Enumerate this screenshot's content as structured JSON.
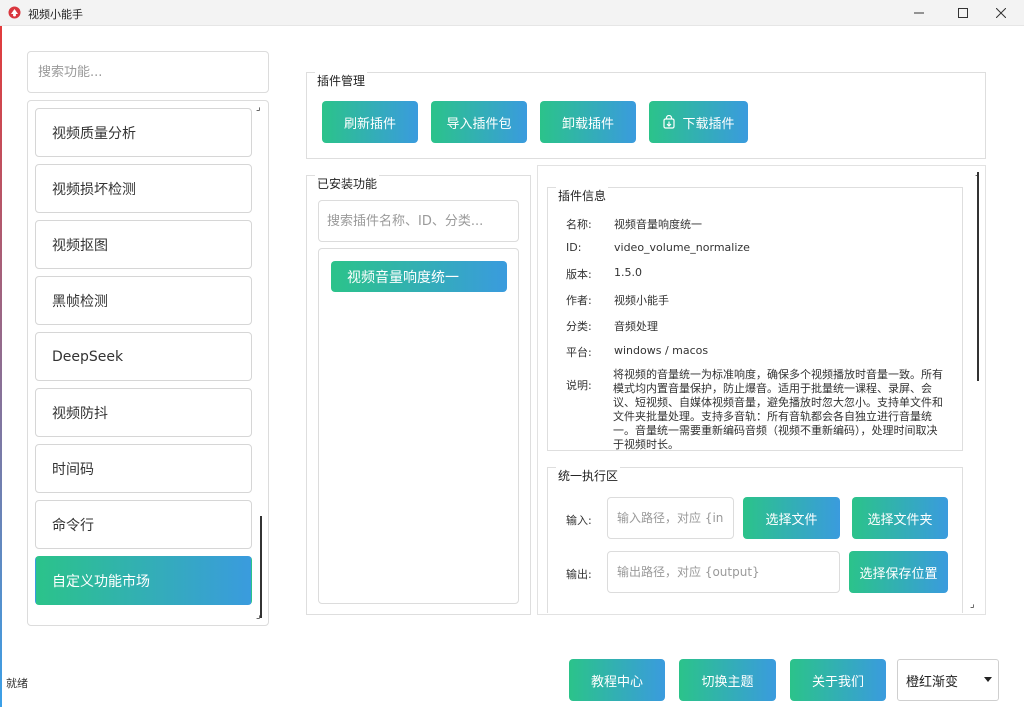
{
  "window": {
    "title": "视频小能手",
    "controls": [
      "minimize-icon",
      "maximize-icon",
      "close-icon"
    ]
  },
  "sidebar": {
    "search_placeholder": "搜索功能...",
    "items": [
      {
        "label": "视频质量分析"
      },
      {
        "label": "视频损坏检测"
      },
      {
        "label": "视频抠图"
      },
      {
        "label": "黑帧检测"
      },
      {
        "label": "DeepSeek"
      },
      {
        "label": "视频防抖"
      },
      {
        "label": "时间码"
      },
      {
        "label": "命令行"
      },
      {
        "label": "自定义功能市场",
        "active": true
      }
    ]
  },
  "plugin_manager": {
    "title": "插件管理",
    "buttons": {
      "refresh": "刷新插件",
      "import": "导入插件包",
      "uninstall": "卸载插件",
      "download": "下载插件"
    }
  },
  "installed": {
    "title": "已安装功能",
    "search_placeholder": "搜索插件名称、ID、分类...",
    "items": [
      "视频音量响度统一"
    ]
  },
  "plugin_info": {
    "title": "插件信息",
    "rows": [
      {
        "key": "名称:",
        "value": "视频音量响度统一"
      },
      {
        "key": "ID:",
        "value": "video_volume_normalize"
      },
      {
        "key": "版本:",
        "value": "1.5.0"
      },
      {
        "key": "作者:",
        "value": "视频小能手"
      },
      {
        "key": "分类:",
        "value": "音频处理"
      },
      {
        "key": "平台:",
        "value": "windows / macos"
      }
    ],
    "desc_key": "说明:",
    "desc_value": "将视频的音量统一为标准响度，确保多个视频播放时音量一致。所有模式均内置音量保护，防止爆音。适用于批量统一课程、录屏、会议、短视频、自媒体视频音量，避免播放时忽大忽小。支持单文件和文件夹批量处理。支持多音轨：所有音轨都会各自独立进行音量统一。音量统一需要重新编码音频（视频不重新编码），处理时间取决于视频时长。"
  },
  "exec": {
    "title": "统一执行区",
    "input_label": "输入:",
    "input_placeholder": "输入路径，对应 {input}",
    "select_file": "选择文件",
    "select_folder": "选择文件夹",
    "output_label": "输出:",
    "output_placeholder": "输出路径，对应 {output}",
    "select_save": "选择保存位置"
  },
  "footer": {
    "status": "就绪",
    "tutorial": "教程中心",
    "switch_theme": "切换主题",
    "about": "关于我们",
    "theme_value": "橙红渐变"
  },
  "colors": {
    "gradient_start": "#2bc38a",
    "gradient_end": "#3a9bde"
  }
}
